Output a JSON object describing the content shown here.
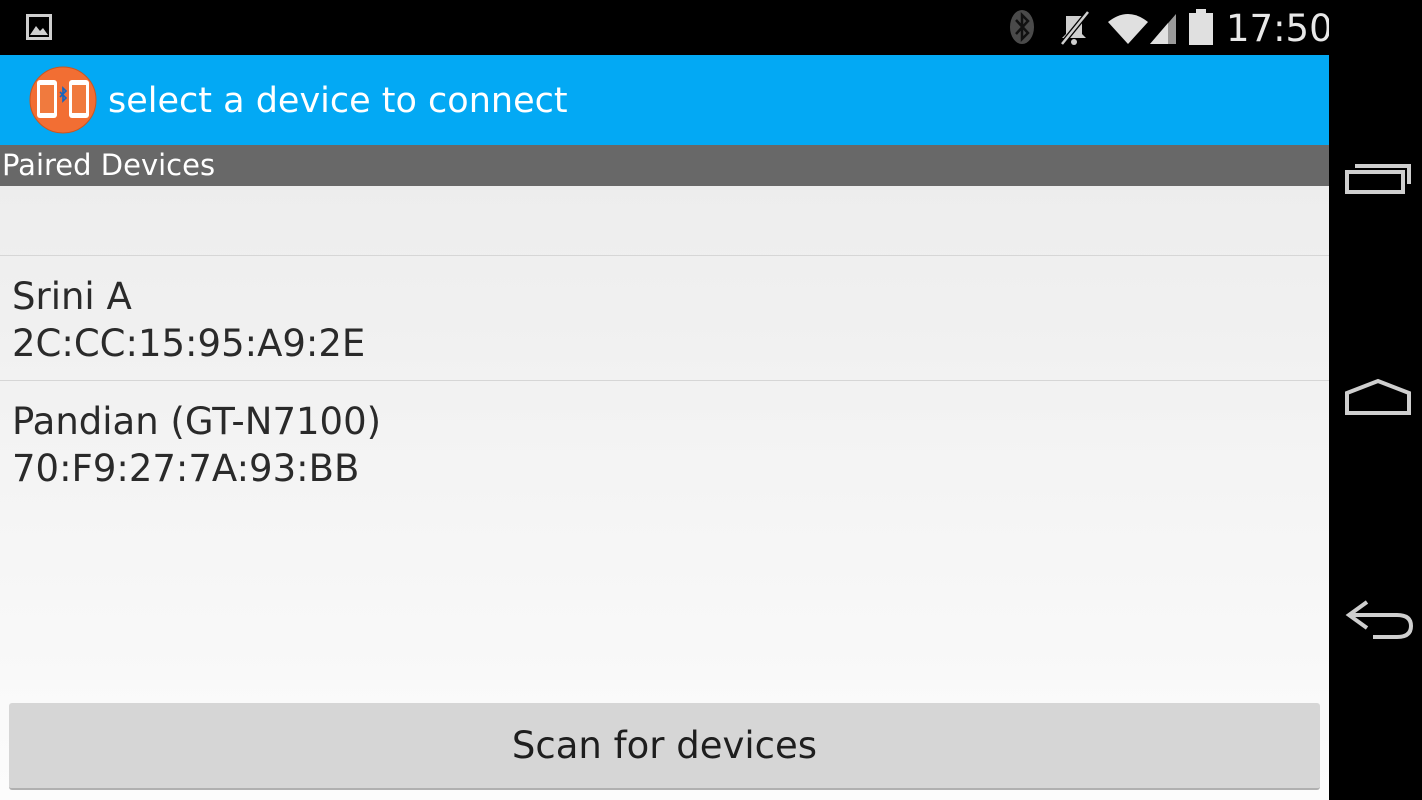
{
  "status_bar": {
    "time": "17:50",
    "icons": [
      "gallery-icon",
      "bluetooth-icon",
      "mute-icon",
      "wifi-icon",
      "cell-signal-icon",
      "battery-icon"
    ]
  },
  "action_bar": {
    "title": "select a device to connect",
    "logo_icon": "bluetooth-phones-logo",
    "color": "#03a9f4"
  },
  "paired_header": "Paired Devices",
  "devices": [
    {
      "name": "Srini A",
      "address": "2C:CC:15:95:A9:2E"
    },
    {
      "name": "Pandian (GT-N7100)",
      "address": "70:F9:27:7A:93:BB"
    }
  ],
  "scan_button": "Scan for devices",
  "nav_bar": [
    "recent-apps-icon",
    "home-icon",
    "back-icon"
  ]
}
